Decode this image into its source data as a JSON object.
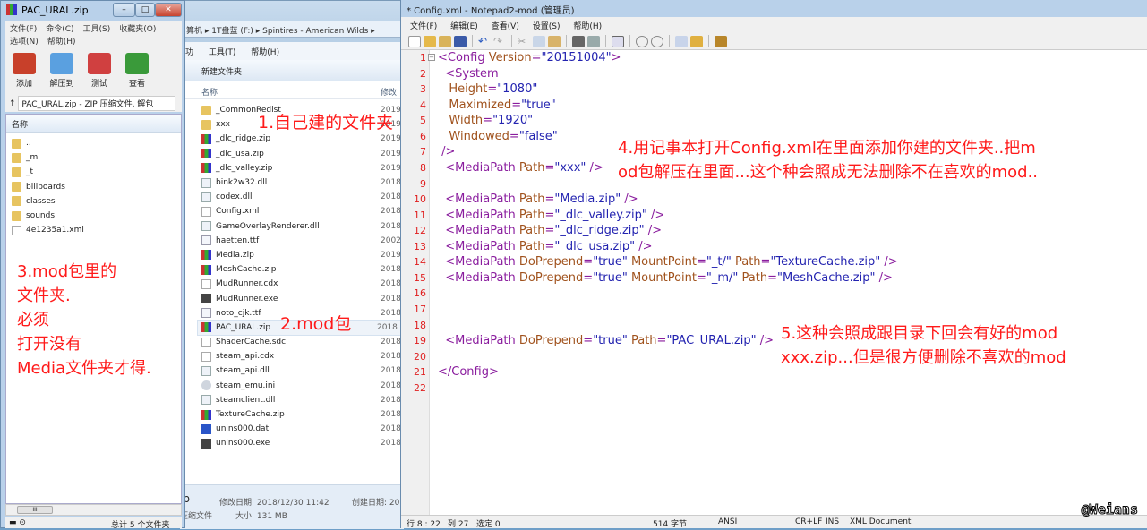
{
  "explorer": {
    "breadcrumb": [
      "算机",
      "1T盘蓝 (F:)",
      "Spintires - American Wilds"
    ],
    "menu": [
      "功",
      "工具(T)",
      "帮助(H)"
    ],
    "new_folder": "新建文件夹",
    "col_name": "名称",
    "col_modified": "修改",
    "files": [
      {
        "name": "_CommonRedist",
        "year": "2019",
        "icon": "folder"
      },
      {
        "name": "xxx",
        "year": "2019",
        "icon": "folder"
      },
      {
        "name": "_dlc_ridge.zip",
        "year": "2019",
        "icon": "zip"
      },
      {
        "name": "_dlc_usa.zip",
        "year": "2019",
        "icon": "zip"
      },
      {
        "name": "_dlc_valley.zip",
        "year": "2019",
        "icon": "zip"
      },
      {
        "name": "bink2w32.dll",
        "year": "2018",
        "icon": "dll"
      },
      {
        "name": "codex.dll",
        "year": "2018",
        "icon": "dll"
      },
      {
        "name": "Config.xml",
        "year": "2018",
        "icon": "file"
      },
      {
        "name": "GameOverlayRenderer.dll",
        "year": "2018",
        "icon": "dll"
      },
      {
        "name": "haetten.ttf",
        "year": "2002",
        "icon": "font"
      },
      {
        "name": "Media.zip",
        "year": "2019",
        "icon": "zip"
      },
      {
        "name": "MeshCache.zip",
        "year": "2018",
        "icon": "zip"
      },
      {
        "name": "MudRunner.cdx",
        "year": "2018",
        "icon": "file"
      },
      {
        "name": "MudRunner.exe",
        "year": "2018",
        "icon": "exe"
      },
      {
        "name": "noto_cjk.ttf",
        "year": "2018",
        "icon": "font"
      },
      {
        "name": "PAC_URAL.zip",
        "year": "2018",
        "icon": "zip",
        "selected": true
      },
      {
        "name": "ShaderCache.sdc",
        "year": "2018",
        "icon": "file"
      },
      {
        "name": "steam_api.cdx",
        "year": "2018",
        "icon": "file"
      },
      {
        "name": "steam_api.dll",
        "year": "2018",
        "icon": "dll"
      },
      {
        "name": "steam_emu.ini",
        "year": "2018",
        "icon": "ini"
      },
      {
        "name": "steamclient.dll",
        "year": "2018",
        "icon": "dll"
      },
      {
        "name": "TextureCache.zip",
        "year": "2018",
        "icon": "zip"
      },
      {
        "name": "unins000.dat",
        "year": "2018",
        "icon": "dat"
      },
      {
        "name": "unins000.exe",
        "year": "2018",
        "icon": "exe"
      }
    ],
    "details": {
      "name": "ip",
      "type": "压缩文件",
      "modified": "修改日期: 2018/12/30 11:42",
      "created": "创建日期: 20",
      "size": "大小: 131 MB"
    }
  },
  "winrar": {
    "title": "PAC_URAL.zip",
    "menu_row1": [
      "文件(F)",
      "命令(C)",
      "工具(S)",
      "收藏夹(O)"
    ],
    "menu_row2": [
      "选项(N)",
      "帮助(H)"
    ],
    "toolbar": [
      {
        "label": "添加",
        "color": "#c8402a"
      },
      {
        "label": "解压到",
        "color": "#5aa0e0"
      },
      {
        "label": "测试",
        "color": "#d04040"
      },
      {
        "label": "查看",
        "color": "#3a9a3a"
      }
    ],
    "path": "PAC_URAL.zip - ZIP 压缩文件, 解包",
    "col_name": "名称",
    "items": [
      {
        "name": "..",
        "icon": "folder"
      },
      {
        "name": "_m",
        "icon": "folder"
      },
      {
        "name": "_t",
        "icon": "folder"
      },
      {
        "name": "billboards",
        "icon": "folder"
      },
      {
        "name": "classes",
        "icon": "folder"
      },
      {
        "name": "sounds",
        "icon": "folder"
      },
      {
        "name": "4e1235a1.xml",
        "icon": "file"
      }
    ],
    "status": "总计 5 个文件夹"
  },
  "notepad": {
    "title": "* Config.xml - Notepad2-mod (管理员)",
    "menu": [
      "文件(F)",
      "编辑(E)",
      "查看(V)",
      "设置(S)",
      "帮助(H)"
    ],
    "code": [
      [
        [
          "tag",
          "<Config "
        ],
        [
          "attr",
          "Version"
        ],
        [
          "tag",
          "="
        ],
        [
          "val",
          "\"20151004\""
        ],
        [
          "tag",
          ">"
        ]
      ],
      [
        [
          "tag",
          "  <System"
        ]
      ],
      [
        [
          "attr",
          "   Height"
        ],
        [
          "tag",
          "="
        ],
        [
          "val",
          "\"1080\""
        ]
      ],
      [
        [
          "attr",
          "   Maximized"
        ],
        [
          "tag",
          "="
        ],
        [
          "val",
          "\"true\""
        ]
      ],
      [
        [
          "attr",
          "   Width"
        ],
        [
          "tag",
          "="
        ],
        [
          "val",
          "\"1920\""
        ]
      ],
      [
        [
          "attr",
          "   Windowed"
        ],
        [
          "tag",
          "="
        ],
        [
          "val",
          "\"false\""
        ]
      ],
      [
        [
          "tag",
          " />"
        ]
      ],
      [
        [
          "tag",
          "  <MediaPath "
        ],
        [
          "attr",
          "Path"
        ],
        [
          "tag",
          "="
        ],
        [
          "val",
          "\"xxx\""
        ],
        [
          "tag",
          " />"
        ]
      ],
      [],
      [
        [
          "tag",
          "  <MediaPath "
        ],
        [
          "attr",
          "Path"
        ],
        [
          "tag",
          "="
        ],
        [
          "val",
          "\"Media.zip\""
        ],
        [
          "tag",
          " />"
        ]
      ],
      [
        [
          "tag",
          "  <MediaPath "
        ],
        [
          "attr",
          "Path"
        ],
        [
          "tag",
          "="
        ],
        [
          "val",
          "\"_dlc_valley.zip\""
        ],
        [
          "tag",
          " />"
        ]
      ],
      [
        [
          "tag",
          "  <MediaPath "
        ],
        [
          "attr",
          "Path"
        ],
        [
          "tag",
          "="
        ],
        [
          "val",
          "\"_dlc_ridge.zip\""
        ],
        [
          "tag",
          " />"
        ]
      ],
      [
        [
          "tag",
          "  <MediaPath "
        ],
        [
          "attr",
          "Path"
        ],
        [
          "tag",
          "="
        ],
        [
          "val",
          "\"_dlc_usa.zip\""
        ],
        [
          "tag",
          " />"
        ]
      ],
      [
        [
          "tag",
          "  <MediaPath "
        ],
        [
          "attr",
          "DoPrepend"
        ],
        [
          "tag",
          "="
        ],
        [
          "val",
          "\"true\" "
        ],
        [
          "attr",
          "MountPoint"
        ],
        [
          "tag",
          "="
        ],
        [
          "val",
          "\"_t/\" "
        ],
        [
          "attr",
          "Path"
        ],
        [
          "tag",
          "="
        ],
        [
          "val",
          "\"TextureCache.zip\""
        ],
        [
          "tag",
          " />"
        ]
      ],
      [
        [
          "tag",
          "  <MediaPath "
        ],
        [
          "attr",
          "DoPrepend"
        ],
        [
          "tag",
          "="
        ],
        [
          "val",
          "\"true\" "
        ],
        [
          "attr",
          "MountPoint"
        ],
        [
          "tag",
          "="
        ],
        [
          "val",
          "\"_m/\" "
        ],
        [
          "attr",
          "Path"
        ],
        [
          "tag",
          "="
        ],
        [
          "val",
          "\"MeshCache.zip\""
        ],
        [
          "tag",
          " />"
        ]
      ],
      [],
      [],
      [],
      [
        [
          "tag",
          "  <MediaPath "
        ],
        [
          "attr",
          "DoPrepend"
        ],
        [
          "tag",
          "="
        ],
        [
          "val",
          "\"true\" "
        ],
        [
          "attr",
          "Path"
        ],
        [
          "tag",
          "="
        ],
        [
          "val",
          "\"PAC_URAL.zip\""
        ],
        [
          "tag",
          " />"
        ]
      ],
      [],
      [
        [
          "tag",
          "</Config>"
        ]
      ],
      []
    ],
    "status": {
      "position": "行 8 : 22",
      "column": "列 27",
      "selection": "选定 0",
      "size": "514 字节",
      "encoding": "ANSI",
      "eol": "CR+LF",
      "mode": "INS",
      "lang": "XML Document"
    }
  },
  "annotations": {
    "note1": "1.自己建的文件夹",
    "note2": "2.mod包",
    "note3": [
      "3.mod包里的",
      "文件夹.",
      "必须",
      "打开没有",
      "Media文件夹才得."
    ],
    "note4": [
      "4.用记事本打开Config.xml在里面添加你建的文件夹..把m",
      "od包解压在里面...这个种会照成无法删除不在喜欢的mod.."
    ],
    "note5": [
      "5.这种会照成跟目录下回会有好的mod",
      "xxx.zip...但是很方便删除不喜欢的mod"
    ]
  },
  "watermark": "@Weians"
}
